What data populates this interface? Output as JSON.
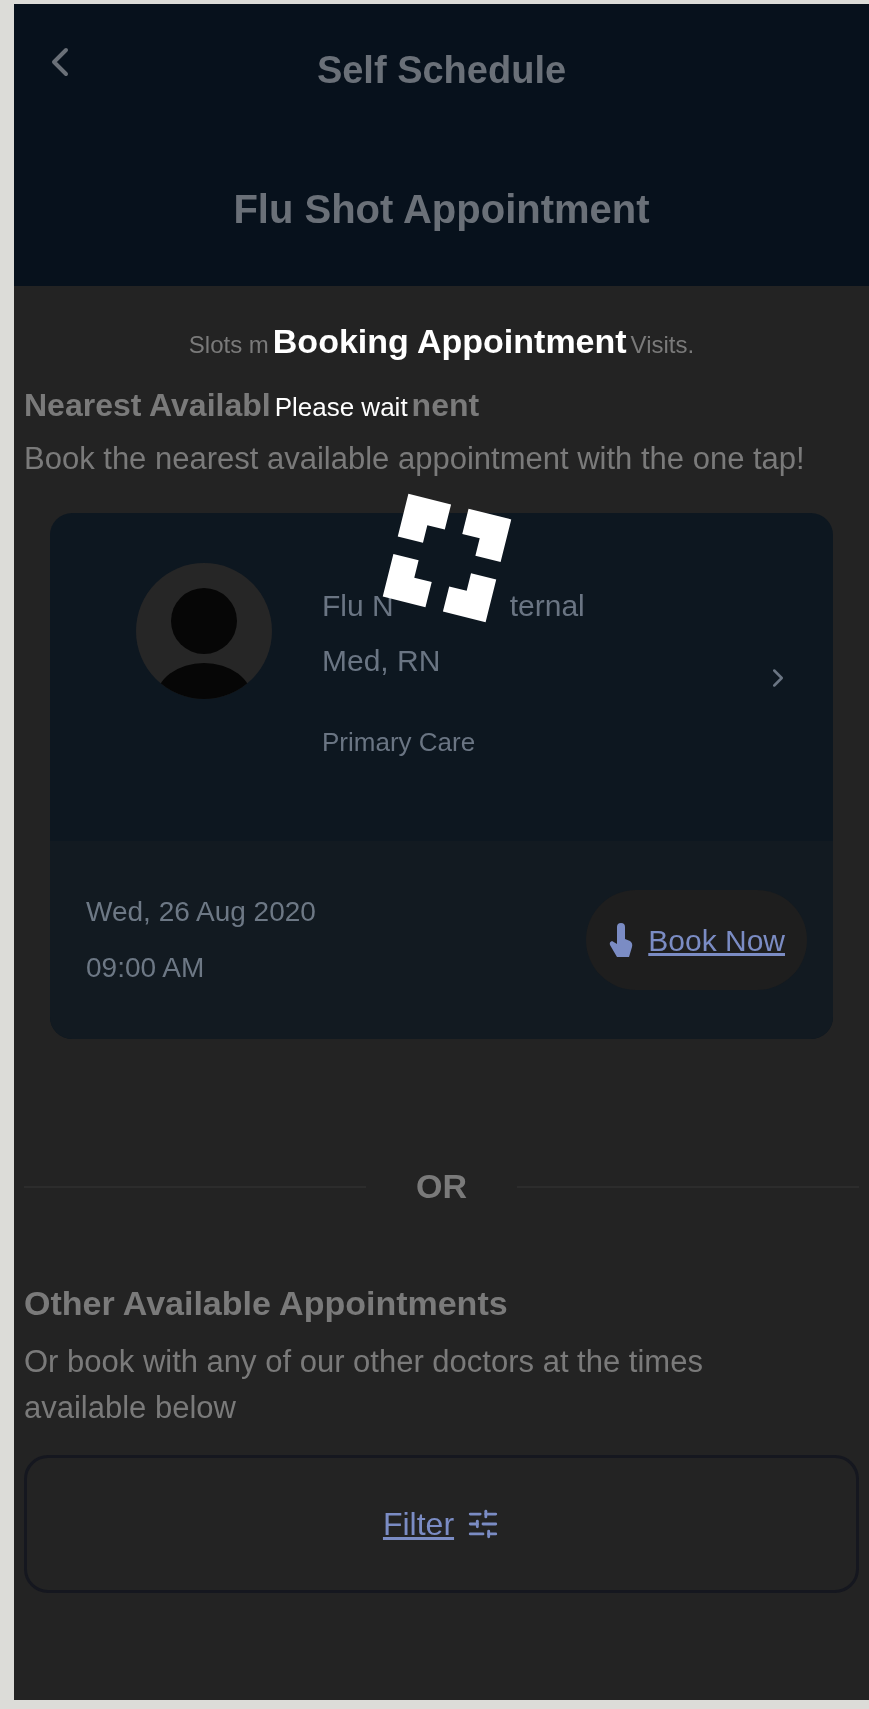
{
  "header": {
    "title": "Self Schedule",
    "subtitle": "Flu Shot Appointment"
  },
  "notice": {
    "before": "Slots m",
    "after": "Visits."
  },
  "loading": {
    "title": "Booking Appointment",
    "message": "Please wait"
  },
  "nearest": {
    "heading_before": "Nearest Availabl",
    "heading_after": "nent",
    "description": "Book the nearest available appointment with the one tap!",
    "card": {
      "name_before": "Flu N",
      "name_after": "ternal",
      "name_line_2": "Med, RN",
      "department": "Primary Care",
      "date": "Wed, 26 Aug 2020",
      "time": "09:00 AM",
      "button": "Book Now"
    }
  },
  "divider": "OR",
  "other": {
    "heading": "Other Available Appointments",
    "description": "Or book with any of our other doctors at the times available below",
    "filter_button": "Filter"
  }
}
